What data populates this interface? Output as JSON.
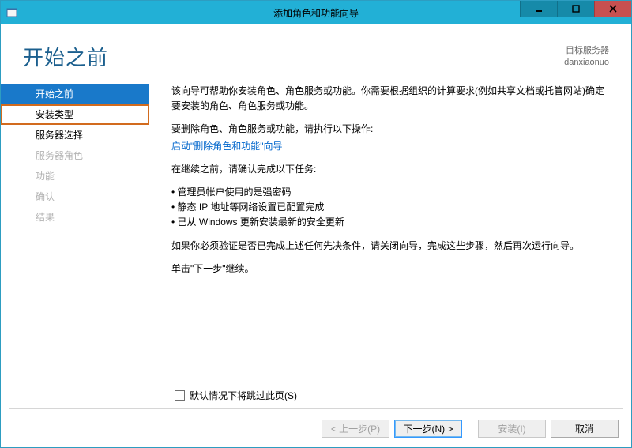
{
  "window": {
    "title": "添加角色和功能向导"
  },
  "header": {
    "page_title": "开始之前",
    "target_label": "目标服务器",
    "target_value": "danxiaonuo"
  },
  "sidebar": {
    "items": [
      {
        "label": "开始之前",
        "state": "selected"
      },
      {
        "label": "安装类型",
        "state": "highlight"
      },
      {
        "label": "服务器选择",
        "state": "normal"
      },
      {
        "label": "服务器角色",
        "state": "disabled"
      },
      {
        "label": "功能",
        "state": "disabled"
      },
      {
        "label": "确认",
        "state": "disabled"
      },
      {
        "label": "结果",
        "state": "disabled"
      }
    ]
  },
  "content": {
    "intro": "该向导可帮助你安装角色、角色服务或功能。你需要根据组织的计算要求(例如共享文档或托管网站)确定要安装的角色、角色服务或功能。",
    "remove_lead": "要删除角色、角色服务或功能，请执行以下操作:",
    "remove_link": "启动\"删除角色和功能\"向导",
    "before_lead": "在继续之前，请确认完成以下任务:",
    "bullets": [
      "管理员帐户使用的是强密码",
      "静态 IP 地址等网络设置已配置完成",
      "已从 Windows 更新安装最新的安全更新"
    ],
    "verify": "如果你必须验证是否已完成上述任何先决条件，请关闭向导，完成这些步骤，然后再次运行向导。",
    "continue": "单击\"下一步\"继续。"
  },
  "skip": {
    "label": "默认情况下将跳过此页(S)",
    "checked": false
  },
  "buttons": {
    "prev": "< 上一步(P)",
    "next": "下一步(N) >",
    "install": "安装(I)",
    "cancel": "取消"
  }
}
